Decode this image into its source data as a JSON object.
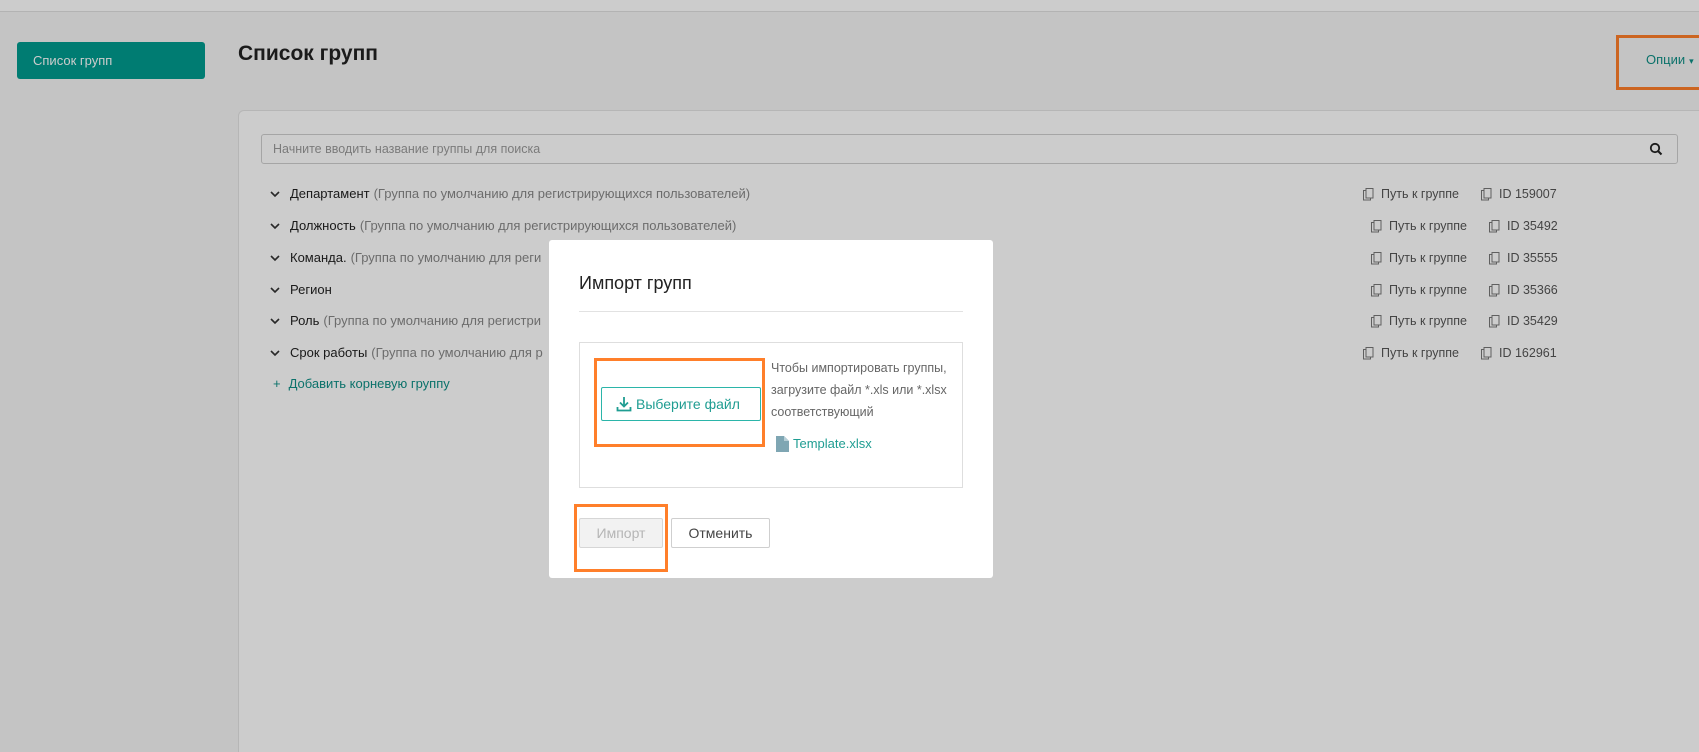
{
  "sidebar": {
    "active_item": "Список групп"
  },
  "header": {
    "title": "Список групп",
    "options_label": "Опции"
  },
  "search": {
    "placeholder": "Начните вводить название группы для поиска",
    "value": ""
  },
  "groups": [
    {
      "name": "Департамент",
      "desc": "(Группа по умолчанию для регистрирующихся пользователей)",
      "path_label": "Путь к группе",
      "id_label": "ID 159007"
    },
    {
      "name": "Должность",
      "desc": "(Группа по умолчанию для регистрирующихся пользователей)",
      "path_label": "Путь к группе",
      "id_label": "ID 35492"
    },
    {
      "name": "Команда.",
      "desc": "(Группа по умолчанию для реги",
      "path_label": "Путь к группе",
      "id_label": "ID 35555"
    },
    {
      "name": "Регион",
      "desc": "",
      "path_label": "Путь к группе",
      "id_label": "ID 35366"
    },
    {
      "name": "Роль",
      "desc": "(Группа по умолчанию для регистри",
      "path_label": "Путь к группе",
      "id_label": "ID 35429"
    },
    {
      "name": "Срок работы",
      "desc": "(Группа по умолчанию для р",
      "path_label": "Путь к группе",
      "id_label": "ID 162961"
    }
  ],
  "add_root_label": "Добавить корневую группу",
  "modal": {
    "title": "Импорт групп",
    "choose_file_label": "Выберите файл",
    "help_text": "Чтобы импортировать группы, загрузите файл *.xls или *.xlsx соответствующий",
    "template_link": "Template.xlsx",
    "import_label": "Импорт",
    "cancel_label": "Отменить"
  },
  "colors": {
    "accent": "#009b8f",
    "highlight": "#ff7f2a"
  }
}
